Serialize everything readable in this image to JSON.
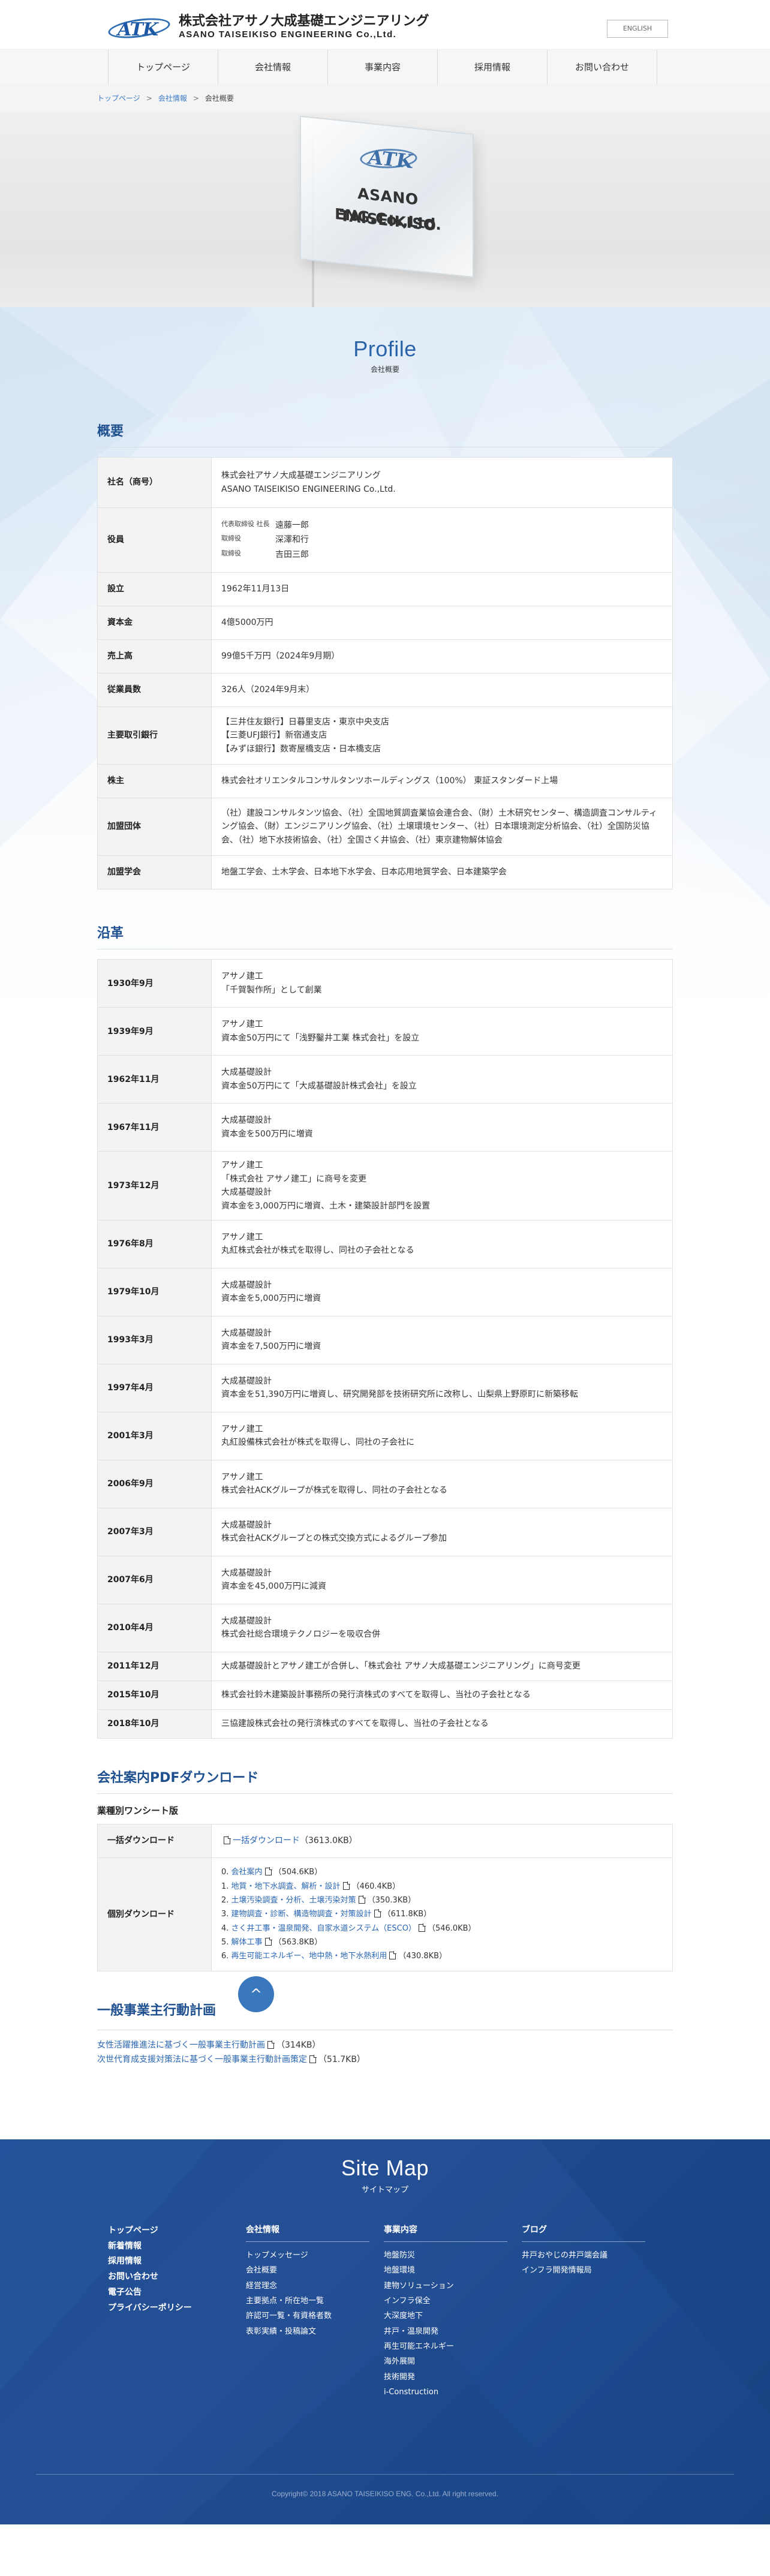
{
  "header": {
    "logo_mark": "ATK",
    "company_jp": "株式会社アサノ大成基礎エンジニアリング",
    "company_en": "ASANO TAISEIKISO ENGINEERING Co.,Ltd.",
    "lang_button": "ENGLISH"
  },
  "nav": {
    "items": [
      {
        "label": "トップページ"
      },
      {
        "label": "会社情報"
      },
      {
        "label": "事業内容"
      },
      {
        "label": "採用情報"
      },
      {
        "label": "お問い合わせ"
      }
    ]
  },
  "breadcrumb": {
    "home": "トップページ",
    "parent": "会社情報",
    "current": "会社概要",
    "sep": ">"
  },
  "hero": {
    "sign_mark": "ATK",
    "sign_line1": "ASANO TAISEIKISO",
    "sign_line2": "ENG.Co.,Ltd."
  },
  "page_heading": {
    "en": "Profile",
    "jp": "会社概要"
  },
  "overview": {
    "title": "概要",
    "rows": [
      {
        "label": "社名（商号）",
        "line1": "株式会社アサノ大成基礎エンジニアリング",
        "line2": "ASANO TAISEIKISO ENGINEERING Co.,Ltd."
      },
      {
        "label": "役員"
      },
      {
        "label": "設立",
        "value": "1962年11月13日"
      },
      {
        "label": "資本金",
        "value": "4億5000万円"
      },
      {
        "label": "売上高",
        "value": "99億5千万円（2024年9月期）"
      },
      {
        "label": "従業員数",
        "value": "326人（2024年9月末）"
      },
      {
        "label": "主要取引銀行",
        "line1": "【三井住友銀行】日暮里支店・東京中央支店",
        "line2": "【三菱UFJ銀行】新宿通支店",
        "line3": "【みずほ銀行】数寄屋橋支店・日本橋支店"
      },
      {
        "label": "株主",
        "value": "株式会社オリエンタルコンサルタンツホールディングス（100%） 東証スタンダード上場"
      },
      {
        "label": "加盟団体",
        "value": "（社）建設コンサルタンツ協会、（社）全国地質調査業協会連合会、（財）土木研究センター、構造調査コンサルティング協会、（財）エンジニアリング協会、（社）土壌環境センター、（社）日本環境測定分析協会、（社）全国防災協会、（社）地下水技術協会、（社）全国さく井協会、（社）東京建物解体協会"
      },
      {
        "label": "加盟学会",
        "value": "地盤工学会、土木学会、日本地下水学会、日本応用地質学会、日本建築学会"
      }
    ],
    "officers": [
      {
        "role": "代表取締役 社長",
        "name": "遠藤一郎"
      },
      {
        "role": "取締役",
        "name": "深澤和行"
      },
      {
        "role": "取締役",
        "name": "吉田三郎"
      }
    ]
  },
  "history": {
    "title": "沿革",
    "rows": [
      {
        "date": "1930年9月",
        "lines": [
          "アサノ建工",
          "「千賀製作所」として創業"
        ]
      },
      {
        "date": "1939年9月",
        "lines": [
          "アサノ建工",
          "資本金50万円にて「浅野鑿井工業 株式会社」を設立"
        ]
      },
      {
        "date": "1962年11月",
        "lines": [
          "大成基礎設計",
          "資本金50万円にて「大成基礎設計株式会社」を設立"
        ]
      },
      {
        "date": "1967年11月",
        "lines": [
          "大成基礎設計",
          "資本金を500万円に増資"
        ]
      },
      {
        "date": "1973年12月",
        "lines": [
          "アサノ建工",
          "「株式会社 アサノ建工」に商号を変更",
          "大成基礎設計",
          "資本金を3,000万円に増資、土木・建築設計部門を設置"
        ]
      },
      {
        "date": "1976年8月",
        "lines": [
          "アサノ建工",
          "丸紅株式会社が株式を取得し、同社の子会社となる"
        ]
      },
      {
        "date": "1979年10月",
        "lines": [
          "大成基礎設計",
          "資本金を5,000万円に増資"
        ]
      },
      {
        "date": "1993年3月",
        "lines": [
          "大成基礎設計",
          "資本金を7,500万円に増資"
        ]
      },
      {
        "date": "1997年4月",
        "lines": [
          "大成基礎設計",
          "資本金を51,390万円に増資し、研究開発部を技術研究所に改称し、山梨県上野原町に新築移転"
        ]
      },
      {
        "date": "2001年3月",
        "lines": [
          "アサノ建工",
          "丸紅設備株式会社が株式を取得し、同社の子会社に"
        ]
      },
      {
        "date": "2006年9月",
        "lines": [
          "アサノ建工",
          "株式会社ACKグループが株式を取得し、同社の子会社となる"
        ]
      },
      {
        "date": "2007年3月",
        "lines": [
          "大成基礎設計",
          "株式会社ACKグループとの株式交換方式によるグループ参加"
        ]
      },
      {
        "date": "2007年6月",
        "lines": [
          "大成基礎設計",
          "資本金を45,000万円に減資"
        ]
      },
      {
        "date": "2010年4月",
        "lines": [
          "大成基礎設計",
          "株式会社総合環境テクノロジーを吸収合併"
        ]
      },
      {
        "date": "2011年12月",
        "lines": [
          "大成基礎設計とアサノ建工が合併し、「株式会社 アサノ大成基礎エンジニアリング」に商号変更"
        ]
      },
      {
        "date": "2015年10月",
        "lines": [
          "株式会社鈴木建築設計事務所の発行済株式のすべてを取得し、当社の子会社となる"
        ]
      },
      {
        "date": "2018年10月",
        "lines": [
          "三協建設株式会社の発行済株式のすべてを取得し、当社の子会社となる"
        ]
      }
    ]
  },
  "pdf": {
    "title": "会社案内PDFダウンロード",
    "subtitle": "業種別ワンシート版",
    "bulk_label": "一括ダウンロード",
    "bulk_link": "一括ダウンロード",
    "bulk_size": "（3613.0KB）",
    "individual_label": "個別ダウンロード",
    "items": [
      {
        "num": "0. ",
        "parts": [
          {
            "t": "会社案内",
            "link": true
          }
        ],
        "size": "（504.6KB）"
      },
      {
        "num": "1. ",
        "parts": [
          {
            "t": "地質・地下水調査、解析・設計",
            "link": true
          }
        ],
        "size": "（460.4KB）"
      },
      {
        "num": "2. ",
        "parts": [
          {
            "t": "土壌汚染調査・分析、土壌汚染対策",
            "link": true
          }
        ],
        "size": "（350.3KB）"
      },
      {
        "num": "3. ",
        "parts": [
          {
            "t": "建物調査・診断、構造物調査・対策設計",
            "link": true
          }
        ],
        "size": "（611.8KB）"
      },
      {
        "num": "4. ",
        "parts": [
          {
            "t": "さく井工事・温泉開発、自家水道システム（ESCO）",
            "link": true
          }
        ],
        "size": "（546.0KB）"
      },
      {
        "num": "5. ",
        "parts": [
          {
            "t": "解体工事",
            "link": true
          }
        ],
        "size": "（563.8KB）"
      },
      {
        "num": "6. ",
        "parts": [
          {
            "t": "再生可能エネルギー、地中熱・地下水熱利用",
            "link": true
          }
        ],
        "size": "（430.8KB）"
      }
    ]
  },
  "plans": {
    "title": "一般事業主行動計画",
    "items": [
      {
        "label": "女性活躍推進法に基づく一般事業主行動計画",
        "size": "（314KB）"
      },
      {
        "label": "次世代育成支援対策法に基づく一般事業主行動計画策定",
        "size": "（51.7KB）"
      }
    ]
  },
  "scroll_top": "^",
  "footer": {
    "title_en": "Site Map",
    "title_jp": "サイトマップ",
    "col1": [
      "トップページ",
      "新着情報",
      "採用情報",
      "お問い合わせ",
      "電子公告",
      "プライバシーポリシー"
    ],
    "col2_head": "会社情報",
    "col2": [
      "トップメッセージ",
      "会社概要",
      "経営理念",
      "主要拠点・所在地一覧",
      "許認可一覧・有資格者数",
      "表彰実績・投稿論文"
    ],
    "col3_head": "事業内容",
    "col3": [
      "地盤防災",
      "地盤環境",
      "建物ソリューション",
      "インフラ保全",
      "大深度地下",
      "井戸・温泉開発",
      "再生可能エネルギー",
      "海外展開",
      "技術開発",
      "i-Construction"
    ],
    "col4_head": "ブログ",
    "col4": [
      "井戸おやじの井戸端会議",
      "インフラ開発情報局"
    ],
    "copyright": "Copyright© 2018 ASANO TAISEIKISO ENG. Co.,Ltd. All right reserved."
  },
  "colors": {
    "brand_blue": "#2a63a8",
    "heading_blue": "#1e4f8e",
    "link_blue": "#2a66b3",
    "footer_blue": "#234f93"
  }
}
